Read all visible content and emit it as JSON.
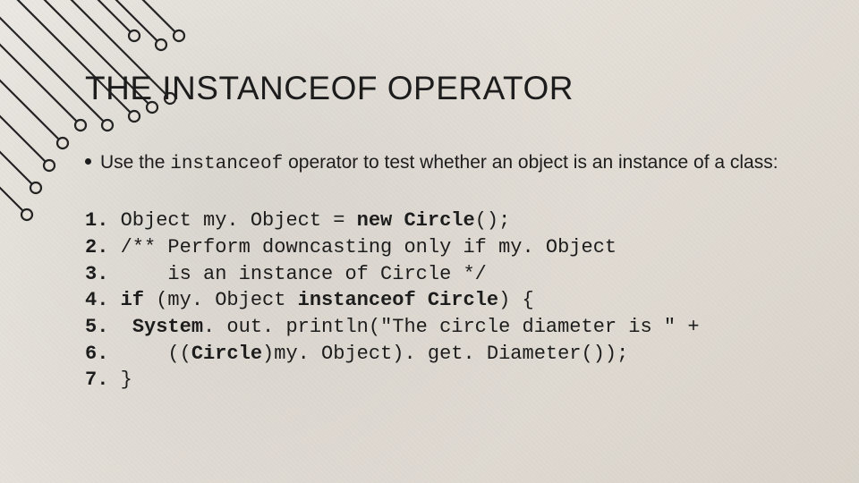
{
  "title": "THE INSTANCEOF OPERATOR",
  "bullet": {
    "pre": "Use the ",
    "code": "instanceof",
    "post": " operator to test whether an object is an instance of a class:"
  },
  "code_lines": [
    {
      "html": "Object my. Object = <b>new Circle</b>();"
    },
    {
      "html": "/** Perform downcasting only if my. Object"
    },
    {
      "html": "    is an instance of Circle */"
    },
    {
      "html": "<b>if</b> (my. Object <b>instanceof Circle</b>) {"
    },
    {
      "html": " <b>System</b>. out. println(\"The circle diameter is \" +"
    },
    {
      "html": "    ((<b>Circle</b>)my. Object). get. Diameter());"
    },
    {
      "html": "}"
    }
  ]
}
